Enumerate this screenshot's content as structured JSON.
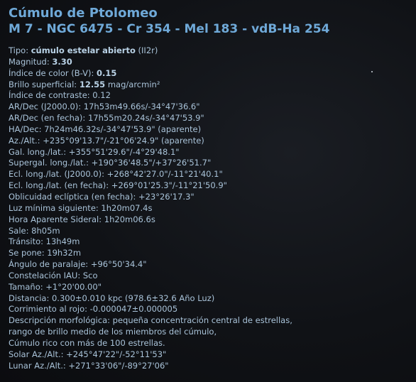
{
  "object": {
    "name": "Cúmulo de Ptolomeo",
    "designations": "M 7 - NGC 6475 - Cr 354 - Mel 183 - vdB-Ha 254"
  },
  "info": {
    "tipo_label": "Tipo: ",
    "tipo_value": "cúmulo estelar abierto",
    "tipo_extra": " (II2r)",
    "magnitud_label": "Magnitud: ",
    "magnitud_value": "3.30",
    "color_label": "Índice de color (B-V): ",
    "color_value": "0.15",
    "brillo_label": "Brillo superficial: ",
    "brillo_value": "12.55",
    "brillo_unit": " mag/arcmin²",
    "contraste": "Índice de contraste: 0.12",
    "ardec_j2000": "AR/Dec (J2000.0): 17h53m49.66s/-34°47'36.6\"",
    "ardec_fecha": "AR/Dec (en fecha): 17h55m20.24s/-34°47'53.9\"",
    "hadec": "HA/Dec: 7h24m46.32s/-34°47'53.9\" (aparente)",
    "azalt": "Az./Alt.: +235°09'13.7\"/-21°06'24.9\" (aparente)",
    "gal": "Gal. long./lat.: +355°51'29.6\"/-4°29'48.1\"",
    "supergal": "Supergal. long./lat.: +190°36'48.5\"/+37°26'51.7\"",
    "ecl_j2000": "Ecl. long./lat. (J2000.0): +268°42'27.0\"/-11°21'40.1\"",
    "ecl_fecha": "Ecl. long./lat. (en fecha): +269°01'25.3\"/-11°21'50.9\"",
    "oblicuidad": "Oblicuidad eclíptica (en fecha): +23°26'17.3\"",
    "luz_minima": "Luz mínima siguiente: 1h20m07.4s",
    "hora_sideral": "Hora Aparente Sideral: 1h20m06.6s",
    "sale": "Sale: 8h05m",
    "transito": "Tránsito: 13h49m",
    "se_pone": "Se pone: 19h32m",
    "paralaje": "Ángulo de paralaje: +96°50'34.4\"",
    "constelacion": "Constelación IAU: Sco",
    "tamano": "Tamaño: +1°20'00.00\"",
    "distancia": "Distancia: 0.300±0.010 kpc (978.6±32.6 Año Luz)",
    "corrimiento": "Corrimiento al rojo: -0.000047±0.000005",
    "descripcion_1": "Descripción morfológica: pequeña concentración central de estrellas,",
    "descripcion_2": "rango de brillo medio de los miembros del cúmulo,",
    "descripcion_3": "Cúmulo rico con más de 100 estrellas.",
    "solar_azalt": "Solar Az./Alt.: +245°47'22\"/-52°11'53\"",
    "lunar_azalt": "Lunar Az./Alt.: +271°33'06\"/-89°27'06\""
  }
}
